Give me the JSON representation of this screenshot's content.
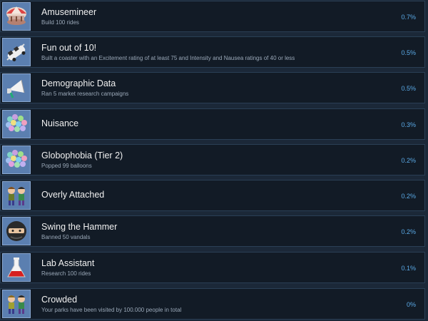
{
  "achievements": [
    {
      "title": "Amusemineer",
      "description": "Build 100 rides",
      "percent": "0.7%",
      "icon": "carousel-icon"
    },
    {
      "title": "Fun out of 10!",
      "description": "Built a coaster with an Excitement rating of at least 75 and Intensity and Nausea ratings of 40 or less",
      "percent": "0.5%",
      "icon": "coaster-car-icon"
    },
    {
      "title": "Demographic Data",
      "description": "Ran 5 market research campaigns",
      "percent": "0.5%",
      "icon": "megaphone-icon"
    },
    {
      "title": "Nuisance",
      "description": "",
      "percent": "0.3%",
      "icon": "balloons-icon"
    },
    {
      "title": "Globophobia (Tier 2)",
      "description": "Popped 99 balloons",
      "percent": "0.2%",
      "icon": "balloons-icon"
    },
    {
      "title": "Overly Attached",
      "description": "",
      "percent": "0.2%",
      "icon": "peeps-icon"
    },
    {
      "title": "Swing the Hammer",
      "description": "Banned 50 vandals",
      "percent": "0.2%",
      "icon": "vandal-icon"
    },
    {
      "title": "Lab Assistant",
      "description": "Research 100 rides",
      "percent": "0.1%",
      "icon": "flask-icon"
    },
    {
      "title": "Crowded",
      "description": "Your parks have been visited by 100.000 people in total",
      "percent": "0%",
      "icon": "peeps-icon"
    }
  ]
}
